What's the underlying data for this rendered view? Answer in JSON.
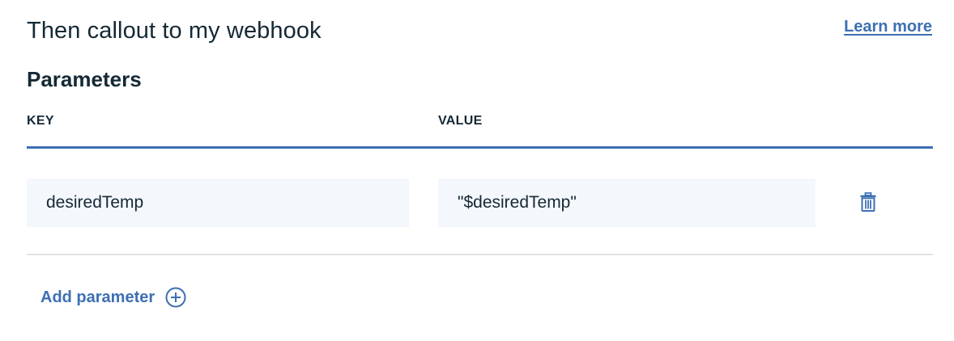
{
  "header": {
    "title": "Then callout to my webhook",
    "learn_more": "Learn more"
  },
  "parameters": {
    "title": "Parameters",
    "columns": {
      "key": "KEY",
      "value": "VALUE"
    },
    "rows": [
      {
        "key": "desiredTemp",
        "value": "\"$desiredTemp\""
      }
    ],
    "add_label": "Add parameter"
  },
  "icons": {
    "delete": "trash-icon",
    "add": "plus-circle-icon"
  },
  "colors": {
    "accent": "#3d70b2",
    "text": "#152935",
    "field_bg": "#f4f7fb",
    "divider": "#dfe3e6"
  }
}
